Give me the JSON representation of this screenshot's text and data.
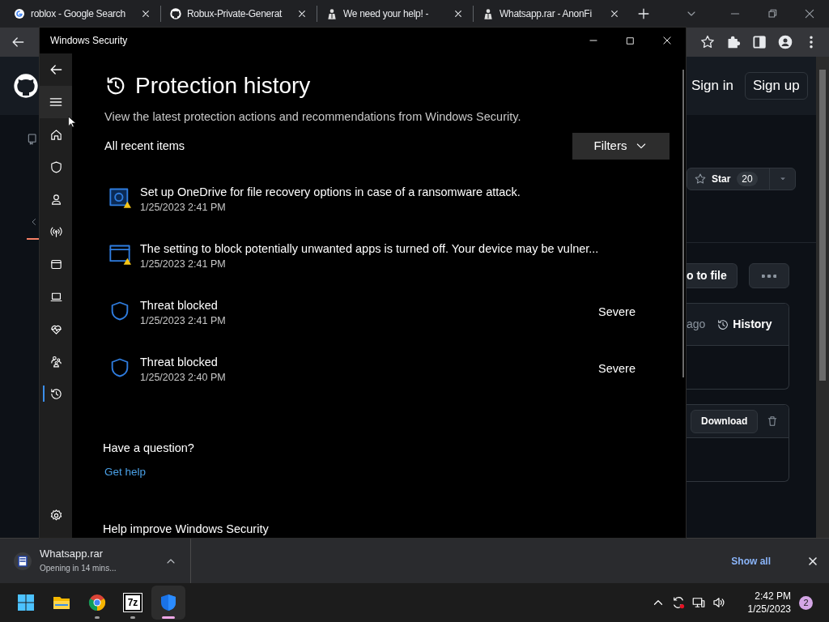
{
  "browser": {
    "tabs": [
      {
        "title": "roblox - Google Search",
        "kind": "google"
      },
      {
        "title": "Robux-Private-Generat",
        "kind": "github"
      },
      {
        "title": "We need your help! -",
        "kind": "figure"
      },
      {
        "title": "Whatsapp.rar - AnonFi",
        "kind": "figure"
      }
    ]
  },
  "page": {
    "sign_in": "Sign in",
    "sign_up": "Sign up",
    "star": "Star",
    "star_count": "20",
    "go_to_file": "o to file",
    "ago": "ago",
    "history": "History",
    "download": "Download"
  },
  "security": {
    "title": "Windows Security",
    "nav": [
      {
        "kind": "home",
        "selected": false
      },
      {
        "kind": "shield",
        "selected": false
      },
      {
        "kind": "account",
        "selected": false
      },
      {
        "kind": "network",
        "selected": false
      },
      {
        "kind": "app",
        "selected": false
      },
      {
        "kind": "device",
        "selected": false
      },
      {
        "kind": "health",
        "selected": false
      },
      {
        "kind": "family",
        "selected": false
      },
      {
        "kind": "history",
        "selected": true
      }
    ],
    "heading": "Protection history",
    "intro": "View the latest protection actions and recommendations from Windows Security.",
    "list_label": "All recent items",
    "filters": "Filters",
    "items": [
      {
        "kind": "onedrive",
        "title": "Set up OneDrive for file recovery options in case of a ransomware attack.",
        "time": "1/25/2023 2:41 PM"
      },
      {
        "kind": "app",
        "title": "The setting to block potentially unwanted apps is turned off. Your device may be vulner...",
        "time": "1/25/2023 2:41 PM"
      },
      {
        "kind": "threat",
        "title": "Threat blocked",
        "time": "1/25/2023 2:41 PM",
        "severity": "Severe"
      },
      {
        "kind": "threat",
        "title": "Threat blocked",
        "time": "1/25/2023 2:40 PM",
        "severity": "Severe"
      }
    ],
    "question": "Have a question?",
    "help_link": "Get help",
    "footer": "Help improve Windows Security"
  },
  "downloads": {
    "file": "Whatsapp.rar",
    "status": "Opening in 14 mins...",
    "show_all": "Show all"
  },
  "taskbar": {
    "apps": [
      {
        "kind": "start",
        "running": false,
        "active": false
      },
      {
        "kind": "folder",
        "running": false,
        "active": false
      },
      {
        "kind": "chrome",
        "running": true,
        "active": false
      },
      {
        "kind": "sevenzip",
        "label": "7z",
        "running": true,
        "active": false
      },
      {
        "kind": "security",
        "running": true,
        "active": true
      }
    ],
    "time": "2:42 PM",
    "date": "1/25/2023",
    "notifications": "2"
  }
}
